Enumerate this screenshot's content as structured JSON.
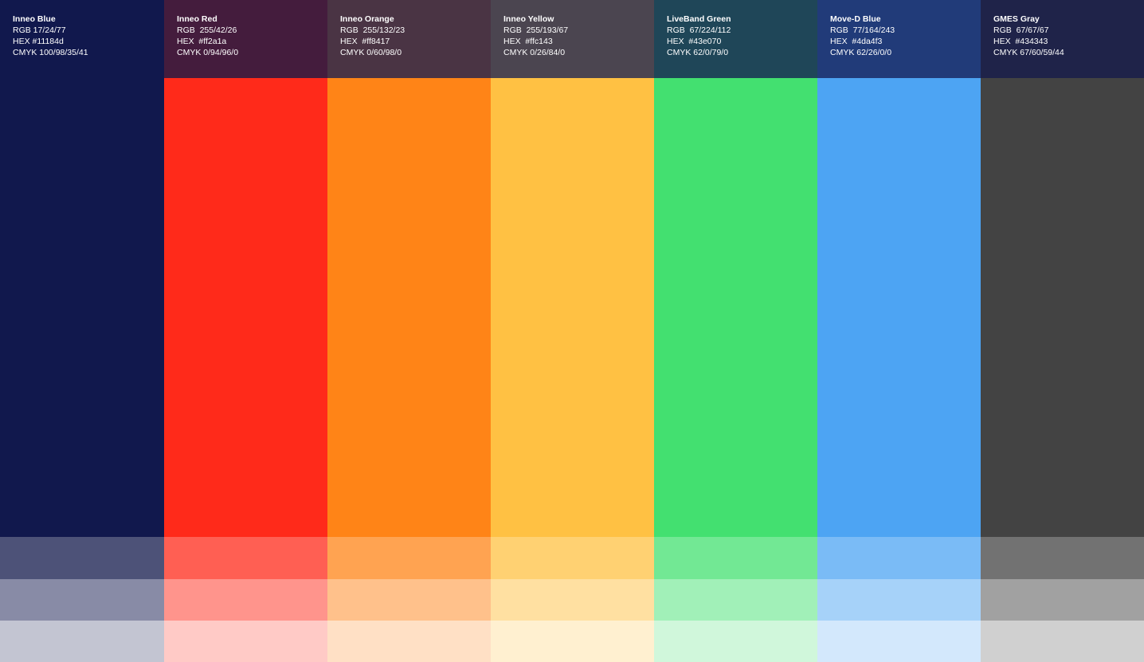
{
  "swatches": [
    {
      "name": "Inneo Blue",
      "rgb_label": "RGB 17/24/77",
      "hex_label": "HEX #11184d",
      "cmyk_label": "CMYK 100/98/35/41",
      "color": "#11184d",
      "header_color": "#11184d",
      "tint_75": "#4d5278",
      "tint_50": "#888ba6",
      "tint_25": "#c3c5d2"
    },
    {
      "name": "Inneo Red",
      "rgb_label": "RGB  255/42/26",
      "hex_label": "HEX  #ff2a1a",
      "cmyk_label": "CMYK 0/94/96/0",
      "color": "#ff2a1a",
      "header_color": "#441c3d",
      "tint_75": "#ff5f53",
      "tint_50": "#ff948c",
      "tint_25": "#ffcac6"
    },
    {
      "name": "Inneo Orange",
      "rgb_label": "RGB  255/132/23",
      "hex_label": "HEX  #ff8417",
      "cmyk_label": "CMYK 0/60/98/0",
      "color": "#ff8417",
      "header_color": "#4a3444",
      "tint_75": "#ffa351",
      "tint_50": "#ffc18b",
      "tint_25": "#ffe0c5"
    },
    {
      "name": "Inneo Yellow",
      "rgb_label": "RGB  255/193/67",
      "hex_label": "HEX  #ffc143",
      "cmyk_label": "CMYK 0/26/84/0",
      "color": "#ffc143",
      "header_color": "#4b4550",
      "tint_75": "#ffd172",
      "tint_50": "#ffe0a1",
      "tint_25": "#fff0d0"
    },
    {
      "name": "LiveBand Green",
      "rgb_label": "RGB  67/224/112",
      "hex_label": "HEX  #43e070",
      "cmyk_label": "CMYK 62/0/79/0",
      "color": "#43e070",
      "header_color": "#1f4658",
      "tint_75": "#72e894",
      "tint_50": "#a1f0b8",
      "tint_25": "#d0f7db"
    },
    {
      "name": "Move-D Blue",
      "rgb_label": "RGB  77/164/243",
      "hex_label": "HEX  #4da4f3",
      "cmyk_label": "CMYK 62/26/0/0",
      "color": "#4da4f3",
      "header_color": "#213b79",
      "tint_75": "#7abbf6",
      "tint_50": "#a6d2f9",
      "tint_25": "#d3e8fc"
    },
    {
      "name": "GMES Gray",
      "rgb_label": "RGB  67/67/67",
      "hex_label": "HEX  #434343",
      "cmyk_label": "CMYK 67/60/59/44",
      "color": "#434343",
      "header_color": "#1f2349",
      "tint_75": "#727272",
      "tint_50": "#a1a1a1",
      "tint_25": "#d0d0d0"
    }
  ]
}
